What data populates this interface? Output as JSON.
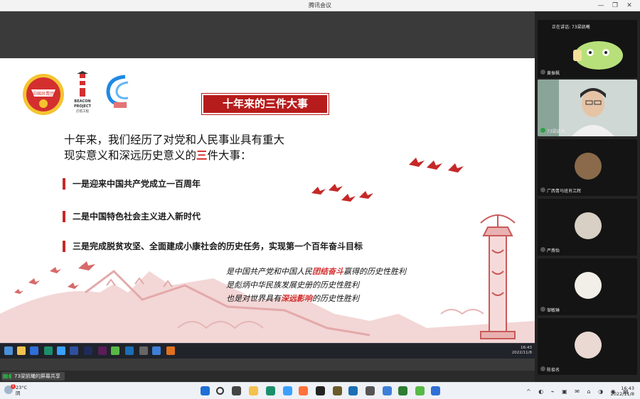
{
  "window": {
    "title": "腾讯会议"
  },
  "slide": {
    "title": "十年来的三件大事",
    "lead_line1": "十年来，我们经历了对党和人民事业具有重大",
    "lead_line2a": "现实意义和深远历史意义的",
    "lead_line2b": "三",
    "lead_line2c": "件大事：",
    "point1": "一是迎来中国共产党成立一百周年",
    "point2": "二是中国特色社会主义进入新时代",
    "point3": "三是完成脱贫攻坚、全面建成小康社会的历史任务，实现第一个百年奋斗目标",
    "quote1a": "是中国共产党和中国人民",
    "quote1b": "团结奋斗",
    "quote1c": "赢得的历史性胜利",
    "quote2": "是彪炳中华民族发展史册的历史性胜利",
    "quote3a": "也是对世界具有",
    "quote3b": "深远影响",
    "quote3c": "的历史性胜利",
    "logo1_text": "中国共青团",
    "logo2_line1": "BEACON",
    "logo2_line2": "PROJECT",
    "logo2_line3": "灯塔工程"
  },
  "remote_taskbar": {
    "time": "16:43",
    "date": "2022/11/8"
  },
  "share": {
    "label": "73梁凯曦的屏幕共享"
  },
  "participants": {
    "speaking_label": "正在讲话: 73梁凯曦",
    "tiles": [
      {
        "name": "黄振枫"
      },
      {
        "name": "73梁凯曦"
      },
      {
        "name": "广西青马班肖江辉"
      },
      {
        "name": "严燕怡"
      },
      {
        "name": "邹敏琳"
      },
      {
        "name": "陈俊名"
      }
    ]
  },
  "win_taskbar": {
    "weather_temp": "23°C",
    "weather_desc": "阴",
    "time": "16:43",
    "date": "2022/11/8",
    "badge": "1"
  },
  "colors": {
    "accent_red": "#b71c1c",
    "panel_bg": "#232323",
    "taskbar_bg": "#eef1f6"
  }
}
